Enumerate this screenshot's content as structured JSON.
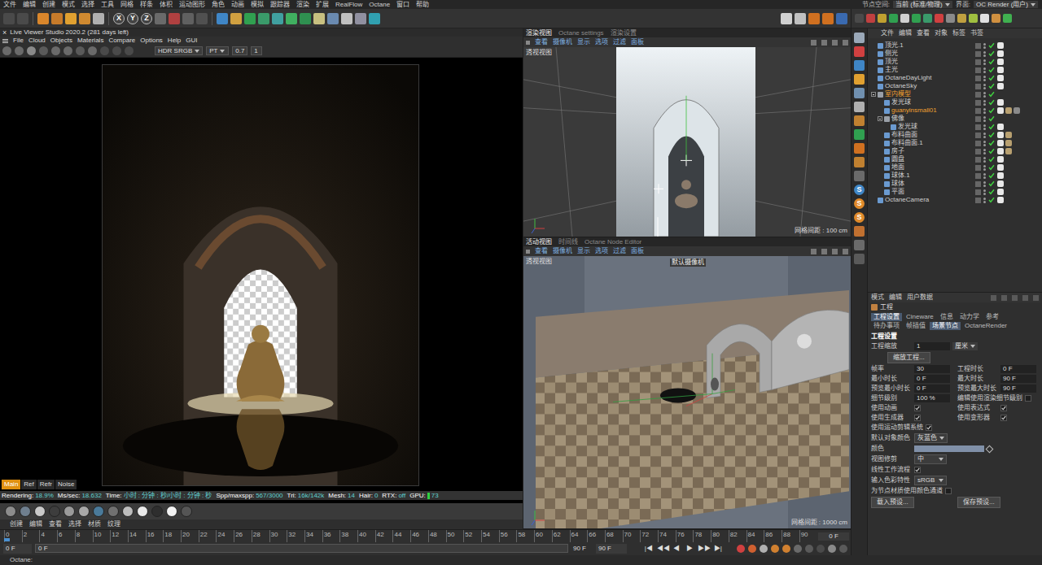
{
  "menubar": {
    "items": [
      "文件",
      "编辑",
      "创建",
      "模式",
      "选择",
      "工具",
      "网格",
      "样条",
      "体积",
      "运动图形",
      "角色",
      "动画",
      "模拟",
      "跟踪器",
      "渲染",
      "扩展",
      "RealFlow",
      "Octane",
      "窗口",
      "帮助"
    ],
    "right": [
      {
        "label": "节点空间:",
        "value": "当前 (标准/物理)"
      },
      {
        "label": "界面:",
        "value": "OC Render (用户)"
      }
    ]
  },
  "toolbar": {
    "axes": [
      "X",
      "Y",
      "Z"
    ]
  },
  "live_viewer": {
    "close": "×",
    "title": "Live Viewer Studio 2020.2 (281 days left)",
    "menu": [
      "File",
      "Cloud",
      "Objects",
      "Materials",
      "Compare",
      "Options",
      "Help",
      "GUI"
    ],
    "controls": [
      {
        "label": "HDR SRGB",
        "kind": "dropdown"
      },
      {
        "label": "PT",
        "kind": "dropdown"
      },
      {
        "label": "0.7",
        "kind": "field"
      },
      {
        "label": "1",
        "kind": "field"
      }
    ],
    "tabs": [
      {
        "label": "Main",
        "selected": true
      },
      {
        "label": "Ref",
        "selected": false
      },
      {
        "label": "Refr",
        "selected": false
      },
      {
        "label": "Noise",
        "selected": false
      }
    ],
    "status": [
      {
        "label": "Rendering:",
        "value": "18.9%"
      },
      {
        "label": "Ms/sec:",
        "value": "18.632"
      },
      {
        "label": "Time:",
        "value": "小时 : 分钟 : 秒/小时 : 分钟 : 秒"
      },
      {
        "label": "Spp/maxspp:",
        "value": "567/3000"
      },
      {
        "label": "Tri:",
        "value": "16k/142k"
      },
      {
        "label": "Mesh:",
        "value": "14"
      },
      {
        "label": "Hair:",
        "value": "0"
      },
      {
        "label": "RTX:",
        "value": "off"
      },
      {
        "label": "GPU:",
        "value": "73"
      }
    ]
  },
  "materials": {
    "menu": [
      "创建",
      "编辑",
      "查看",
      "选择",
      "材质",
      "纹理"
    ],
    "swatches": [
      {
        "color": "#8c8c8c"
      },
      {
        "color": "#6f7f8f"
      },
      {
        "color": "#c9c9c9"
      },
      {
        "color": "#3d3d3d"
      },
      {
        "color": "#9a9a9a"
      },
      {
        "color": "#a8a8a8"
      },
      {
        "color": "#4a7a9a"
      },
      {
        "color": "#707070"
      },
      {
        "color": "#bdbdbd"
      },
      {
        "color": "#eaeaea"
      },
      {
        "color": "#2e2e2e"
      },
      {
        "color": "#f2f2f2"
      },
      {
        "color": "#555555"
      }
    ]
  },
  "viewport_top": {
    "tabs": [
      {
        "label": "渲染视图",
        "selected": true
      },
      {
        "label": "Octane settings",
        "selected": false
      },
      {
        "label": "渲染设置",
        "selected": false
      }
    ],
    "menu": [
      "查看",
      "摄像机",
      "显示",
      "选项",
      "过滤",
      "面板"
    ],
    "view": "透视视图",
    "grid": "网格间距 : 100 cm"
  },
  "viewport_bottom": {
    "tabs": [
      {
        "label": "活动视图",
        "selected": true
      },
      {
        "label": "时间线",
        "selected": false
      },
      {
        "label": "Octane Node Editor",
        "selected": false
      }
    ],
    "menu": [
      "查看",
      "摄像机",
      "显示",
      "选项",
      "过滤",
      "面板"
    ],
    "view": "透视视图",
    "camera": "默认摄像机",
    "grid": "网格间距 : 1000 cm"
  },
  "side_strip": {
    "letters": [
      "S",
      "S",
      "S"
    ]
  },
  "object_manager": {
    "menu": [
      "文件",
      "编辑",
      "查看",
      "对象",
      "标签",
      "书签"
    ],
    "objects": [
      {
        "name": "顶光.1",
        "depth": 0,
        "kind": "object",
        "expanded": false,
        "highlight": false,
        "enabled": true,
        "tags": 1
      },
      {
        "name": "侧光",
        "depth": 0,
        "kind": "object",
        "expanded": false,
        "highlight": false,
        "enabled": true,
        "tags": 1
      },
      {
        "name": "顶光",
        "depth": 0,
        "kind": "object",
        "expanded": false,
        "highlight": false,
        "enabled": true,
        "tags": 1
      },
      {
        "name": "主光",
        "depth": 0,
        "kind": "object",
        "expanded": false,
        "highlight": false,
        "enabled": true,
        "tags": 1
      },
      {
        "name": "OctaneDayLight",
        "depth": 0,
        "kind": "object",
        "expanded": false,
        "highlight": false,
        "enabled": true,
        "tags": 1
      },
      {
        "name": "OctaneSky",
        "depth": 0,
        "kind": "object",
        "expanded": false,
        "highlight": false,
        "enabled": true,
        "tags": 1
      },
      {
        "name": "室内模型",
        "depth": 0,
        "kind": "group",
        "expanded": true,
        "highlight": true,
        "enabled": true,
        "tags": 0
      },
      {
        "name": "发光球",
        "depth": 1,
        "kind": "object",
        "expanded": false,
        "highlight": false,
        "enabled": true,
        "tags": 1
      },
      {
        "name": "guanyinsmall01",
        "depth": 1,
        "kind": "object",
        "expanded": false,
        "highlight": true,
        "enabled": true,
        "tags": 3
      },
      {
        "name": "佛像",
        "depth": 1,
        "kind": "group",
        "expanded": true,
        "highlight": false,
        "enabled": true,
        "tags": 0
      },
      {
        "name": "发光球",
        "depth": 2,
        "kind": "object",
        "expanded": false,
        "highlight": false,
        "enabled": true,
        "tags": 1
      },
      {
        "name": "布料曲面",
        "depth": 1,
        "kind": "object",
        "expanded": false,
        "highlight": false,
        "enabled": true,
        "tags": 2
      },
      {
        "name": "布料曲面.1",
        "depth": 1,
        "kind": "object",
        "expanded": false,
        "highlight": false,
        "enabled": true,
        "tags": 2
      },
      {
        "name": "房子",
        "depth": 1,
        "kind": "object",
        "expanded": false,
        "highlight": false,
        "enabled": true,
        "tags": 2
      },
      {
        "name": "圆盘",
        "depth": 1,
        "kind": "object",
        "expanded": false,
        "highlight": false,
        "enabled": true,
        "tags": 1
      },
      {
        "name": "地面",
        "depth": 1,
        "kind": "object",
        "expanded": false,
        "highlight": false,
        "enabled": true,
        "tags": 1
      },
      {
        "name": "球体.1",
        "depth": 1,
        "kind": "object",
        "expanded": false,
        "highlight": false,
        "enabled": true,
        "tags": 1
      },
      {
        "name": "球体",
        "depth": 1,
        "kind": "object",
        "expanded": false,
        "highlight": false,
        "enabled": true,
        "tags": 1
      },
      {
        "name": "平面",
        "depth": 1,
        "kind": "object",
        "expanded": false,
        "highlight": false,
        "enabled": true,
        "tags": 1
      },
      {
        "name": "OctaneCamera",
        "depth": 0,
        "kind": "object",
        "expanded": false,
        "highlight": false,
        "enabled": true,
        "tags": 1
      }
    ]
  },
  "attributes": {
    "menu": [
      "模式",
      "编辑",
      "用户数据"
    ],
    "title": "工程",
    "tabs_row1": [
      {
        "label": "工程设置",
        "selected": true
      },
      {
        "label": "Cineware",
        "selected": false
      },
      {
        "label": "信息",
        "selected": false
      },
      {
        "label": "动力学",
        "selected": false
      },
      {
        "label": "参考",
        "selected": false
      }
    ],
    "tabs_row2": [
      {
        "label": "待办事项",
        "selected": false
      },
      {
        "label": "帧插值",
        "selected": false
      },
      {
        "label": "场景节点",
        "selected": true
      },
      {
        "label": "OctaneRender",
        "selected": false
      }
    ],
    "section": "工程设置",
    "rows": [
      [
        {
          "kind": "field",
          "label": "工程缩放",
          "value": "1",
          "unit": "厘米"
        }
      ],
      [
        {
          "kind": "button",
          "label": "缩放工程..."
        }
      ],
      [
        {
          "kind": "field",
          "label": "帧率",
          "value": "30"
        },
        {
          "kind": "field",
          "label": "工程时长",
          "value": "0 F"
        }
      ],
      [
        {
          "kind": "field",
          "label": "最小时长",
          "value": "0 F"
        },
        {
          "kind": "field",
          "label": "最大时长",
          "value": "90 F"
        }
      ],
      [
        {
          "kind": "field",
          "label": "预览最小时长",
          "value": "0 F"
        },
        {
          "kind": "field",
          "label": "预览最大时长",
          "value": "90 F"
        }
      ],
      [
        {
          "kind": "field",
          "label": "细节级别",
          "value": "100 %"
        },
        {
          "kind": "check",
          "label": "编辑使用渲染细节级别",
          "checked": false
        }
      ],
      [
        {
          "kind": "check",
          "label": "使用动画",
          "checked": true
        },
        {
          "kind": "check",
          "label": "使用表达式",
          "checked": true
        }
      ],
      [
        {
          "kind": "check",
          "label": "使用生成器",
          "checked": true
        },
        {
          "kind": "check",
          "label": "使用变形器",
          "checked": true
        }
      ],
      [
        {
          "kind": "check",
          "label": "使用运动剪辑系统",
          "checked": true
        }
      ],
      [
        {
          "kind": "dropdown",
          "label": "默认对象颜色",
          "value": "灰蓝色"
        }
      ],
      [
        {
          "kind": "color",
          "label": "颜色"
        }
      ],
      [
        {
          "kind": "dropdown",
          "label": "视图修剪",
          "value": "中"
        }
      ],
      [
        {
          "kind": "check",
          "label": "线性工作流程",
          "checked": true
        }
      ],
      [
        {
          "kind": "dropdown",
          "label": "输入色彩特性",
          "value": "sRGB"
        }
      ],
      [
        {
          "kind": "check",
          "label": "为节点材质使用颜色通道",
          "checked": false
        }
      ],
      [
        {
          "kind": "button",
          "label": "载入预设..."
        },
        {
          "kind": "button",
          "label": "保存预设..."
        }
      ]
    ]
  },
  "timeline": {
    "ticks": [
      "0",
      "2",
      "4",
      "6",
      "8",
      "10",
      "12",
      "14",
      "16",
      "18",
      "20",
      "22",
      "24",
      "26",
      "28",
      "30",
      "32",
      "34",
      "36",
      "38",
      "40",
      "42",
      "44",
      "46",
      "48",
      "50",
      "52",
      "54",
      "56",
      "58",
      "60",
      "62",
      "64",
      "66",
      "68",
      "70",
      "72",
      "74",
      "76",
      "78",
      "80",
      "82",
      "84",
      "86",
      "88",
      "90"
    ],
    "playhead": 0,
    "frame": "0 F",
    "start": "0 F",
    "range_start": "0 F",
    "range_end": "90 F",
    "end": "90 F",
    "controls": [
      "|◀",
      "◀◀",
      "◀",
      "▶",
      "▶▶",
      "▶|"
    ]
  },
  "status_bar": "Octane:"
}
